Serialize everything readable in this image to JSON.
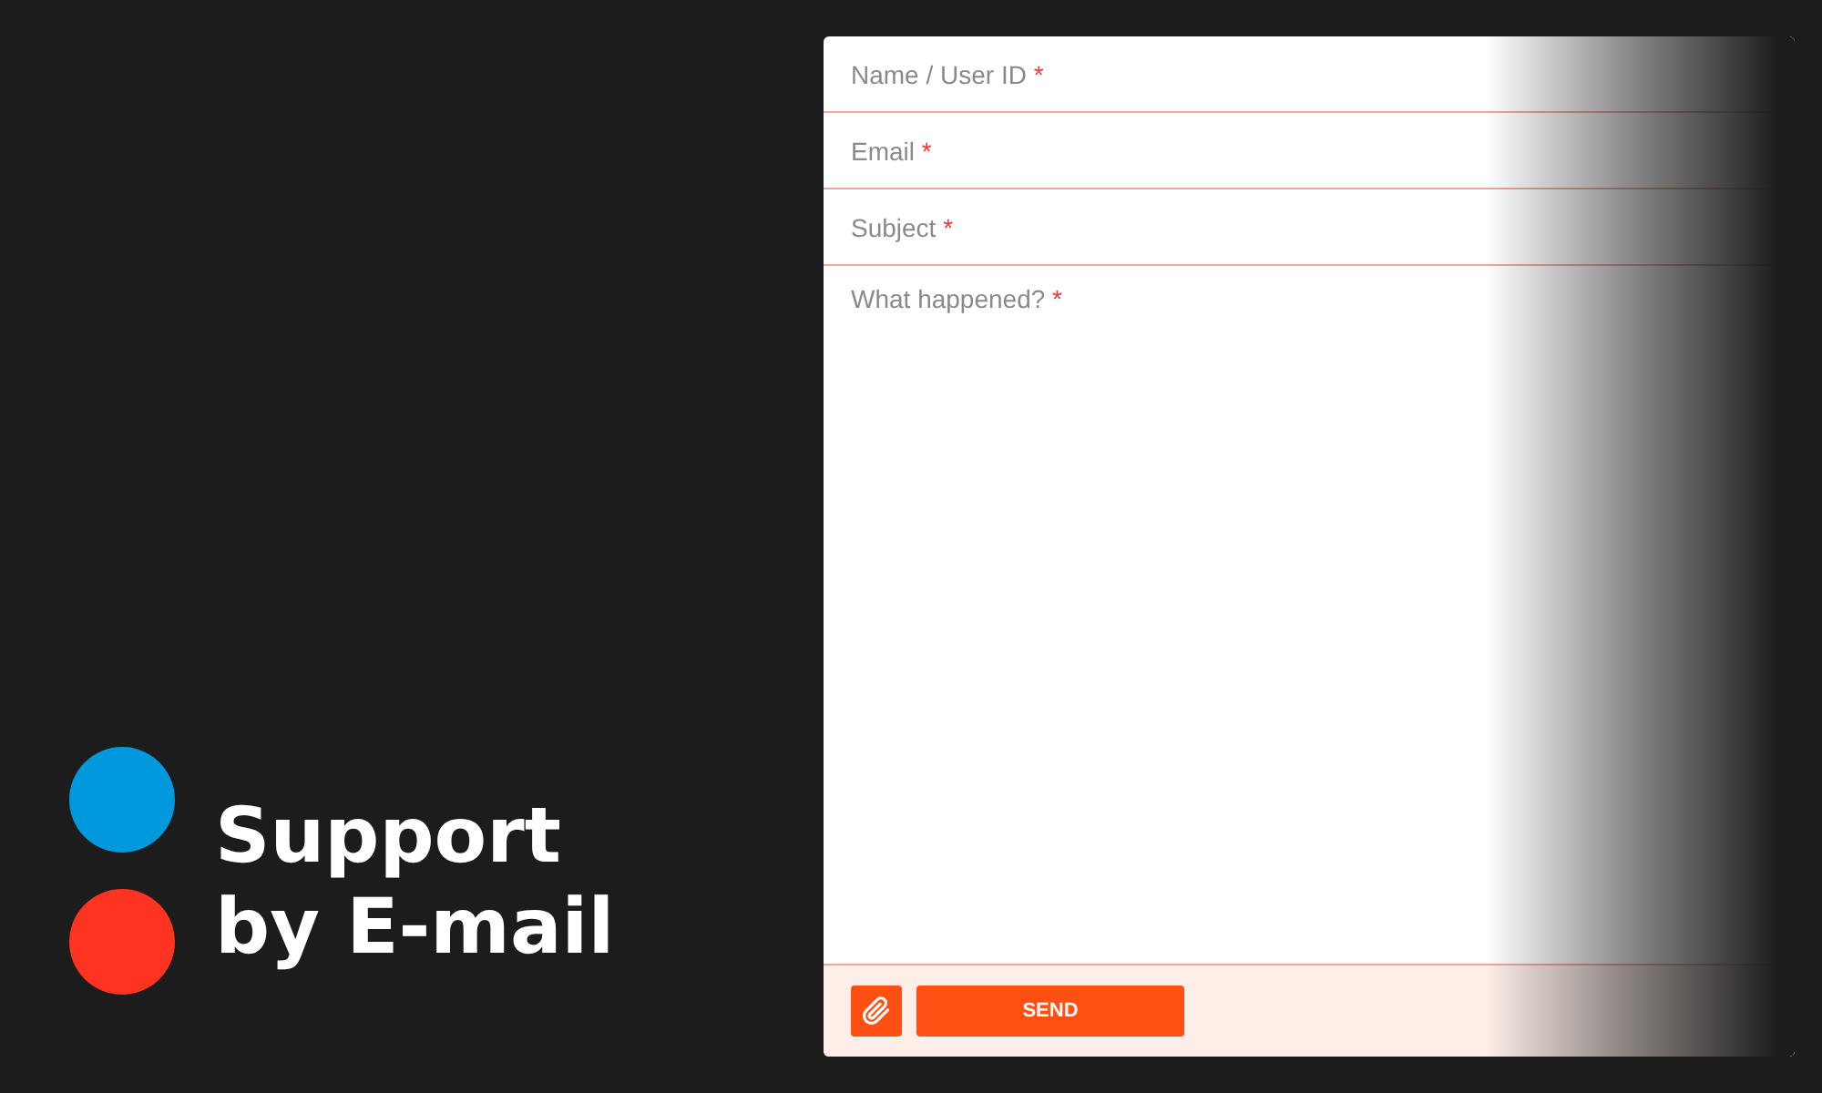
{
  "brand": {
    "dots": [
      {
        "color": "#0099dd"
      },
      {
        "color": "#ff3322"
      }
    ],
    "title_lines": [
      "Support",
      "by E-mail"
    ]
  },
  "form": {
    "fields": [
      {
        "kind": "line",
        "placeholder": "Name / User ID",
        "required_mark": "*"
      },
      {
        "kind": "line",
        "placeholder": "Email",
        "required_mark": "*"
      },
      {
        "kind": "line",
        "placeholder": "Subject",
        "required_mark": "*"
      },
      {
        "kind": "area",
        "placeholder": "What happened?",
        "required_mark": "*"
      }
    ],
    "send_button": "SEND"
  }
}
